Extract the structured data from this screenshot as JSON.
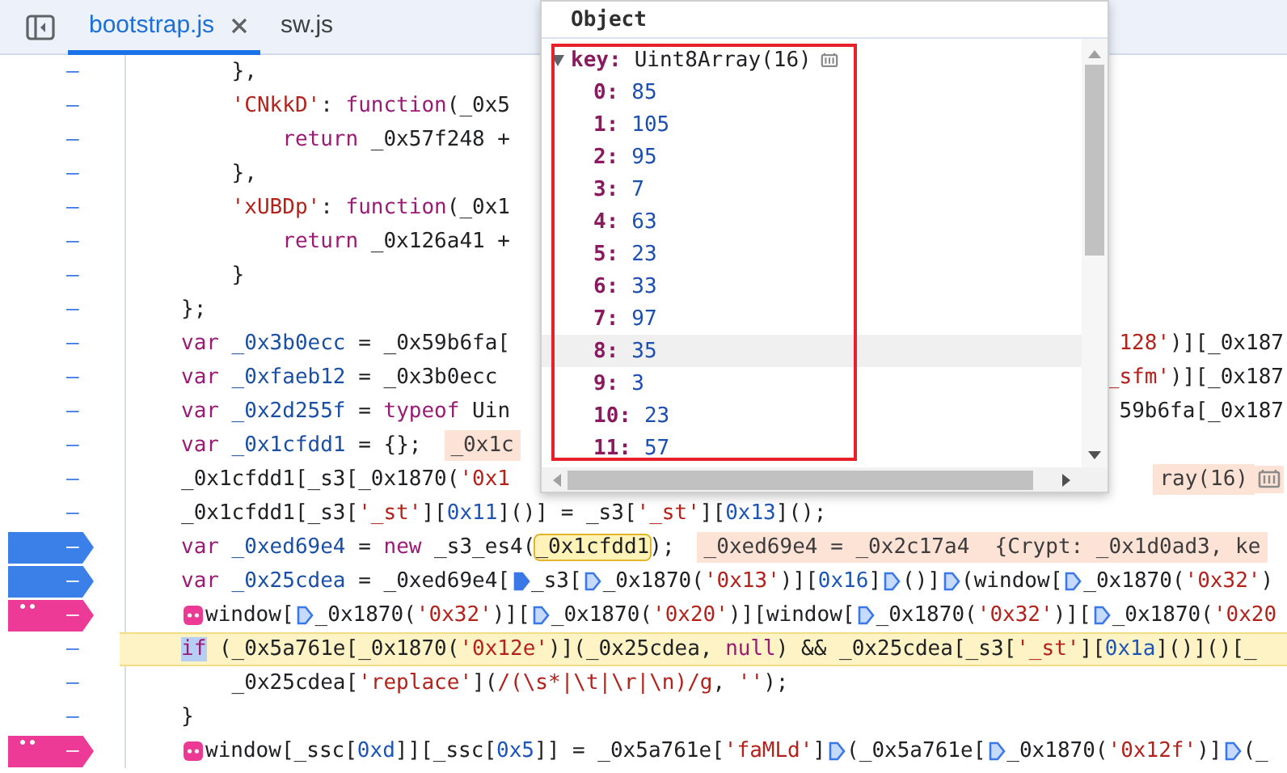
{
  "tabs": [
    {
      "label": "bootstrap.js",
      "selected": true,
      "closable": true
    },
    {
      "label": "sw.js",
      "selected": false,
      "closable": false
    }
  ],
  "code_lines": [
    {
      "gutter": "–",
      "current": false,
      "code": [
        {
          "kind": "p",
          "text": "    },"
        }
      ]
    },
    {
      "gutter": "–",
      "current": false,
      "code": [
        {
          "kind": "s",
          "text": "    'CNkkD'"
        },
        {
          "kind": "p",
          "text": ": "
        },
        {
          "kind": "kw",
          "text": "function"
        },
        {
          "kind": "p",
          "text": "(_0x5"
        }
      ]
    },
    {
      "gutter": "–",
      "current": false,
      "code": [
        {
          "kind": "kw",
          "text": "        return"
        },
        {
          "kind": "p",
          "text": " _0x57f248 +"
        }
      ]
    },
    {
      "gutter": "–",
      "current": false,
      "code": [
        {
          "kind": "p",
          "text": "    },"
        }
      ]
    },
    {
      "gutter": "–",
      "current": false,
      "code": [
        {
          "kind": "s",
          "text": "    'xUBDp'"
        },
        {
          "kind": "p",
          "text": ": "
        },
        {
          "kind": "kw",
          "text": "function"
        },
        {
          "kind": "p",
          "text": "(_0x1"
        }
      ]
    },
    {
      "gutter": "–",
      "current": false,
      "code": [
        {
          "kind": "kw",
          "text": "        return"
        },
        {
          "kind": "p",
          "text": " _0x126a41 +"
        }
      ]
    },
    {
      "gutter": "–",
      "current": false,
      "code": [
        {
          "kind": "p",
          "text": "    }"
        }
      ]
    },
    {
      "gutter": "–",
      "current": false,
      "code": [
        {
          "kind": "p",
          "text": "};"
        }
      ]
    },
    {
      "gutter": "–",
      "current": false,
      "code": [
        {
          "kind": "kw",
          "text": "var"
        },
        {
          "kind": "d",
          "text": " _0x3b0ecc"
        },
        {
          "kind": "p",
          "text": " = _0x59b6fa["
        }
      ],
      "tail": [
        {
          "kind": "s",
          "text": "128'"
        },
        {
          "kind": "p",
          "text": ")][_0x187"
        }
      ]
    },
    {
      "gutter": "–",
      "current": false,
      "code": [
        {
          "kind": "kw",
          "text": "var"
        },
        {
          "kind": "d",
          "text": " _0xfaeb12"
        },
        {
          "kind": "p",
          "text": " = _0x3b0ecc"
        }
      ],
      "tail": [
        {
          "kind": "s",
          "text": "_sfm'"
        },
        {
          "kind": "p",
          "text": ")][_0x187"
        }
      ]
    },
    {
      "gutter": "–",
      "current": false,
      "code": [
        {
          "kind": "kw",
          "text": "var"
        },
        {
          "kind": "d",
          "text": " _0x2d255f"
        },
        {
          "kind": "p",
          "text": " = "
        },
        {
          "kind": "kw",
          "text": "typeof"
        },
        {
          "kind": "p",
          "text": " Uin"
        }
      ],
      "tail": [
        {
          "kind": "p",
          "text": "59b6fa[_0x187"
        }
      ]
    },
    {
      "gutter": "–",
      "current": false,
      "code": [
        {
          "kind": "kw",
          "text": "var"
        },
        {
          "kind": "d",
          "text": " _0x1cfdd1"
        },
        {
          "kind": "p",
          "text": " = {};"
        },
        {
          "kind": "v",
          "text": "_0x1c"
        }
      ]
    },
    {
      "gutter": "–",
      "current": false,
      "code": [
        {
          "kind": "p",
          "text": "_0x1cfdd1[_s3[_0x1870("
        },
        {
          "kind": "s",
          "text": "'0x1"
        }
      ],
      "tail": [
        {
          "kind": "v",
          "text": "ray(16)"
        },
        {
          "kind": "mem"
        }
      ]
    },
    {
      "gutter": "–",
      "current": false,
      "code": [
        {
          "kind": "p",
          "text": "_0x1cfdd1[_s3["
        },
        {
          "kind": "s",
          "text": "'_st'"
        },
        {
          "kind": "p",
          "text": "]["
        },
        {
          "kind": "n",
          "text": "0x11"
        },
        {
          "kind": "p",
          "text": "]()] = _s3["
        },
        {
          "kind": "s",
          "text": "'_st'"
        },
        {
          "kind": "p",
          "text": "]["
        },
        {
          "kind": "n",
          "text": "0x13"
        },
        {
          "kind": "p",
          "text": "]();"
        }
      ]
    },
    {
      "gutter": "–",
      "kind": "breakpoint",
      "current": false,
      "code": [
        {
          "kind": "kw",
          "text": "var"
        },
        {
          "kind": "d",
          "text": " _0xed69e4"
        },
        {
          "kind": "p",
          "text": " = "
        },
        {
          "kind": "kw",
          "text": "new"
        },
        {
          "kind": "p",
          "text": " _s3_es4("
        },
        {
          "kind": "hov",
          "text": "_0x1cfdd1"
        },
        {
          "kind": "p",
          "text": ");"
        },
        {
          "kind": "v",
          "text": "_0xed69e4 = _0x2c17a4  {Crypt: _0x1d0ad3, ke"
        }
      ]
    },
    {
      "gutter": "–",
      "kind": "breakpoint",
      "current": false,
      "code": [
        {
          "kind": "kw",
          "text": "var"
        },
        {
          "kind": "d",
          "text": " _0x25cdea"
        },
        {
          "kind": "p",
          "text": " = _0xed69e4["
        },
        {
          "kind": "stepf"
        },
        {
          "kind": "p",
          "text": "_s3["
        },
        {
          "kind": "step"
        },
        {
          "kind": "p",
          "text": "_0x1870("
        },
        {
          "kind": "s",
          "text": "'0x13'"
        },
        {
          "kind": "p",
          "text": ")]["
        },
        {
          "kind": "n",
          "text": "0x16"
        },
        {
          "kind": "p",
          "text": "]"
        },
        {
          "kind": "step"
        },
        {
          "kind": "p",
          "text": "()]"
        },
        {
          "kind": "step"
        },
        {
          "kind": "p",
          "text": "(window["
        },
        {
          "kind": "step"
        },
        {
          "kind": "p",
          "text": "_0x1870("
        },
        {
          "kind": "s",
          "text": "'0x32'"
        },
        {
          "kind": "p",
          "text": ")"
        }
      ]
    },
    {
      "gutter": "–",
      "kind": "logpoint",
      "current": false,
      "code": [
        {
          "kind": "bp"
        },
        {
          "kind": "p",
          "text": "window["
        },
        {
          "kind": "step"
        },
        {
          "kind": "p",
          "text": "_0x1870("
        },
        {
          "kind": "s",
          "text": "'0x32'"
        },
        {
          "kind": "p",
          "text": ")]["
        },
        {
          "kind": "step"
        },
        {
          "kind": "p",
          "text": "_0x1870("
        },
        {
          "kind": "s",
          "text": "'0x20'"
        },
        {
          "kind": "p",
          "text": ")][window["
        },
        {
          "kind": "step"
        },
        {
          "kind": "p",
          "text": "_0x1870("
        },
        {
          "kind": "s",
          "text": "'0x32'"
        },
        {
          "kind": "p",
          "text": ")]["
        },
        {
          "kind": "step"
        },
        {
          "kind": "p",
          "text": "_0x1870("
        },
        {
          "kind": "s",
          "text": "'0x20"
        }
      ]
    },
    {
      "gutter": "–",
      "current": true,
      "code": [
        {
          "kind": "sel",
          "text": "if"
        },
        {
          "kind": "p",
          "text": " (_0x5a761e[_0x1870("
        },
        {
          "kind": "s",
          "text": "'0x12e'"
        },
        {
          "kind": "p",
          "text": ")](_0x25cdea, "
        },
        {
          "kind": "kw",
          "text": "null"
        },
        {
          "kind": "p",
          "text": ") && _0x25cdea[_s3["
        },
        {
          "kind": "s",
          "text": "'_st'"
        },
        {
          "kind": "p",
          "text": "]["
        },
        {
          "kind": "n",
          "text": "0x1a"
        },
        {
          "kind": "p",
          "text": "]()]()[_"
        }
      ]
    },
    {
      "gutter": "–",
      "current": false,
      "code": [
        {
          "kind": "p",
          "text": "    _0x25cdea["
        },
        {
          "kind": "s",
          "text": "'replace'"
        },
        {
          "kind": "p",
          "text": "]("
        },
        {
          "kind": "s",
          "text": "/(\\s*|\\t|\\r|\\n)/g"
        },
        {
          "kind": "p",
          "text": ", "
        },
        {
          "kind": "s",
          "text": "''"
        },
        {
          "kind": "p",
          "text": ");"
        }
      ]
    },
    {
      "gutter": "–",
      "current": false,
      "code": [
        {
          "kind": "p",
          "text": "}"
        }
      ]
    },
    {
      "gutter": "–",
      "kind": "logpoint",
      "current": false,
      "code": [
        {
          "kind": "bp"
        },
        {
          "kind": "p",
          "text": "window[_ssc["
        },
        {
          "kind": "n",
          "text": "0xd"
        },
        {
          "kind": "p",
          "text": "]][_ssc["
        },
        {
          "kind": "n",
          "text": "0x5"
        },
        {
          "kind": "p",
          "text": "]] = _0x5a761e["
        },
        {
          "kind": "s",
          "text": "'faMLd'"
        },
        {
          "kind": "p",
          "text": "]"
        },
        {
          "kind": "step"
        },
        {
          "kind": "p",
          "text": "(_0x5a761e["
        },
        {
          "kind": "step"
        },
        {
          "kind": "p",
          "text": "_0x1870("
        },
        {
          "kind": "s",
          "text": "'0x12f'"
        },
        {
          "kind": "p",
          "text": ")]"
        },
        {
          "kind": "step"
        },
        {
          "kind": "p",
          "text": "(_"
        }
      ]
    }
  ],
  "popover": {
    "title": "Object",
    "property": {
      "name": "key:",
      "type": "Uint8Array(16)",
      "expanded": true,
      "children": [
        {
          "index": "0:",
          "value": "85",
          "hovered": false
        },
        {
          "index": "1:",
          "value": "105",
          "hovered": false
        },
        {
          "index": "2:",
          "value": "95",
          "hovered": false
        },
        {
          "index": "3:",
          "value": "7",
          "hovered": false
        },
        {
          "index": "4:",
          "value": "63",
          "hovered": false
        },
        {
          "index": "5:",
          "value": "23",
          "hovered": false
        },
        {
          "index": "6:",
          "value": "33",
          "hovered": false
        },
        {
          "index": "7:",
          "value": "97",
          "hovered": false
        },
        {
          "index": "8:",
          "value": "35",
          "hovered": true
        },
        {
          "index": "9:",
          "value": "3",
          "hovered": false
        },
        {
          "index": "10:",
          "value": "23",
          "hovered": false
        },
        {
          "index": "11:",
          "value": "57",
          "hovered": false
        }
      ]
    }
  }
}
